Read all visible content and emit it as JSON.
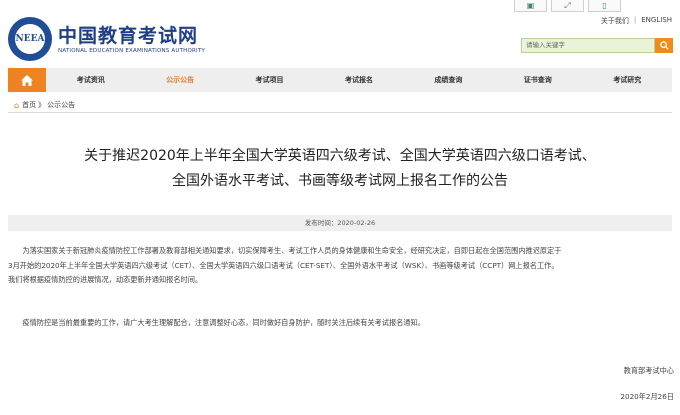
{
  "top_icons": [
    "gift-icon",
    "expand-icon",
    "mobile-icon"
  ],
  "top_links": {
    "about": "关于我们",
    "english": "ENGLISH"
  },
  "logo": {
    "cn": "中国教育考试网",
    "en": "NATIONAL EDUCATION EXAMINATIONS AUTHORITY",
    "emblem": "NEEA"
  },
  "search": {
    "placeholder": "请输入关键字"
  },
  "nav": {
    "items": [
      "考试资讯",
      "公示公告",
      "考试项目",
      "考试报名",
      "成绩查询",
      "证书查询",
      "考试研究"
    ],
    "active_index": 1
  },
  "breadcrumb": {
    "home": "首页",
    "sep": "》",
    "current": "公示公告"
  },
  "article": {
    "title_line1": "关于推迟2020年上半年全国大学英语四六级考试、全国大学英语四六级口语考试、",
    "title_line2": "全国外语水平考试、书画等级考试网上报名工作的公告",
    "publish_time": "发布时间：2020-02-26",
    "para1_line1": "为落实国家关于新冠肺炎疫情防控工作部署及教育部相关通知要求，切实保障考生、考试工作人员的身体健康和生命安全，经研究决定，自即日起在全国范围内推迟原定于",
    "para1_line2": "3月开始的2020年上半年全国大学英语四六级考试（CET）、全国大学英语四六级口语考试（CET-SET）、全国外语水平考试（WSK）、书画等级考试（CCPT）网上报名工作。",
    "para1_line3": "我们将根据疫情防控的进展情况，动态更新并通知报名时间。",
    "para2": "疫情防控是当前最重要的工作，请广大考生理解配合，注意调整好心态，同时做好自身防护，随时关注后续有关考试报名通知。",
    "signature": "教育部考试中心",
    "date": "2020年2月26日"
  },
  "colors": {
    "brand_blue": "#1e3f86",
    "accent_orange": "#ef8321",
    "search_bg": "#eaf3d9"
  }
}
